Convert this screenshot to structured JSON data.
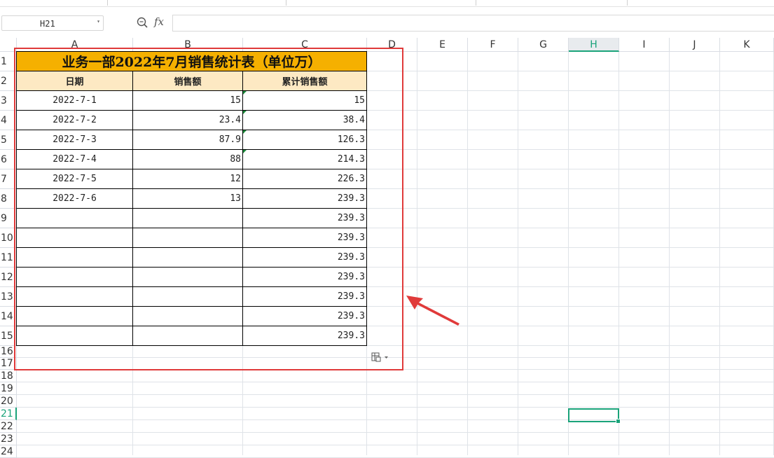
{
  "formula_bar": {
    "name_box": "H21",
    "formula_icon": "fx",
    "formula": ""
  },
  "columns": [
    "A",
    "B",
    "C",
    "D",
    "E",
    "F",
    "G",
    "H",
    "I",
    "J",
    "K"
  ],
  "rows": [
    "1",
    "2",
    "3",
    "4",
    "5",
    "6",
    "7",
    "8",
    "9",
    "10",
    "11",
    "12",
    "13",
    "14",
    "15",
    "16",
    "17",
    "18",
    "19",
    "20",
    "21",
    "22",
    "23",
    "24"
  ],
  "selected": {
    "cell": "H21",
    "column": "H",
    "row": "21"
  },
  "sheet": {
    "title": "业务一部2022年7月销售统计表（单位万）",
    "headers": [
      "日期",
      "销售额",
      "累计销售额"
    ],
    "rows": [
      [
        "2022-7-1",
        "15",
        "15"
      ],
      [
        "2022-7-2",
        "23.4",
        "38.4"
      ],
      [
        "2022-7-3",
        "87.9",
        "126.3"
      ],
      [
        "2022-7-4",
        "88",
        "214.3"
      ],
      [
        "2022-7-5",
        "12",
        "226.3"
      ],
      [
        "2022-7-6",
        "13",
        "239.3"
      ],
      [
        "",
        "",
        "239.3"
      ],
      [
        "",
        "",
        "239.3"
      ],
      [
        "",
        "",
        "239.3"
      ],
      [
        "",
        "",
        "239.3"
      ],
      [
        "",
        "",
        "239.3"
      ],
      [
        "",
        "",
        "239.3"
      ],
      [
        "",
        "",
        "239.3"
      ]
    ]
  },
  "colors": {
    "title_fill": "#f5b000",
    "header_fill": "#fde9c3",
    "annotation_red": "#e03a3a",
    "selection_green": "#1aa37a"
  },
  "icons": [
    "zoom-icon",
    "fx-icon",
    "paste-options-icon",
    "annotation-arrow-icon"
  ]
}
